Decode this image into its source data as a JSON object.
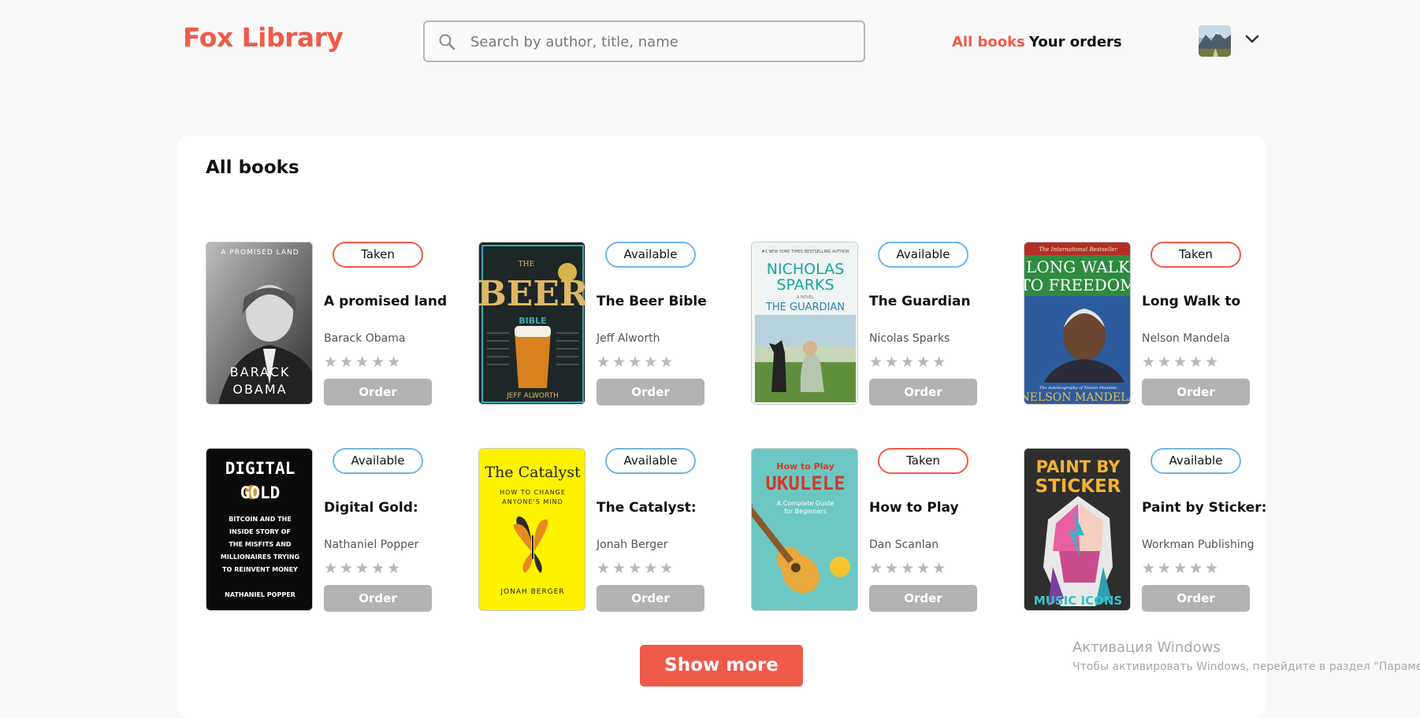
{
  "header": {
    "logo": "Fox Library",
    "search_placeholder": "Search by author, title, name",
    "nav": {
      "all_books": "All books",
      "your_orders": "Your orders"
    }
  },
  "main": {
    "title": "All books",
    "books": [
      {
        "title": "A promised land",
        "author": "Barack Obama",
        "status": "Taken",
        "rating": 0,
        "order_label": "Order",
        "cover_text": [
          "A PROMISED LAND",
          "BARACK",
          "OBAMA"
        ]
      },
      {
        "title": "The Beer Bible",
        "author": "Jeff Alworth",
        "status": "Available",
        "rating": 0,
        "order_label": "Order",
        "cover_text": [
          "THE",
          "BEER",
          "BIBLE",
          "JEFF ALWORTH"
        ]
      },
      {
        "title": "The Guardian",
        "author": "Nicolas Sparks",
        "status": "Available",
        "rating": 0,
        "order_label": "Order",
        "cover_text": [
          "#1 NEW YORK TIMES BESTSELLING AUTHOR",
          "NICHOLAS",
          "SPARKS",
          "A NOVEL",
          "THE GUARDIAN"
        ]
      },
      {
        "title": "Long Walk to",
        "author": "Nelson Mandela",
        "status": "Taken",
        "rating": 0,
        "order_label": "Order",
        "cover_text": [
          "The International Bestseller",
          "LONG WALK",
          "TO FREEDOM",
          "The Autobiography of Nelson Mandela",
          "NELSON MANDELA"
        ]
      },
      {
        "title": "Digital Gold:",
        "author": "Nathaniel Popper",
        "status": "Available",
        "rating": 0,
        "order_label": "Order",
        "cover_text": [
          "DIGITAL",
          "GOLD",
          "BITCOIN AND THE",
          "INSIDE STORY OF",
          "THE MISFITS AND",
          "MILLIONAIRES TRYING",
          "TO REINVENT MONEY",
          "NATHANIEL POPPER"
        ]
      },
      {
        "title": "The Catalyst:",
        "author": "Jonah Berger",
        "status": "Available",
        "rating": 0,
        "order_label": "Order",
        "cover_text": [
          "The Catalyst",
          "HOW TO CHANGE",
          "ANYONE'S MIND",
          "JONAH BERGER"
        ]
      },
      {
        "title": "How to Play",
        "author": "Dan Scanlan",
        "status": "Taken",
        "rating": 0,
        "order_label": "Order",
        "cover_text": [
          "How to Play",
          "UKULELE",
          "A Complete Guide",
          "for Beginners"
        ]
      },
      {
        "title": "Paint by Sticker:",
        "author": "Workman Publishing",
        "status": "Available",
        "rating": 0,
        "order_label": "Order",
        "cover_text": [
          "PAINT BY",
          "STICKER",
          "MUSIC ICONS"
        ]
      }
    ],
    "show_more": "Show more"
  },
  "watermark": {
    "line1": "Активация Windows",
    "line2": "Чтобы активировать Windows, перейдите в раздел \"Параметры\"."
  },
  "colors": {
    "accent": "#f05a4a",
    "available": "#6fb6e6",
    "button_gray": "#b3b3b3"
  }
}
